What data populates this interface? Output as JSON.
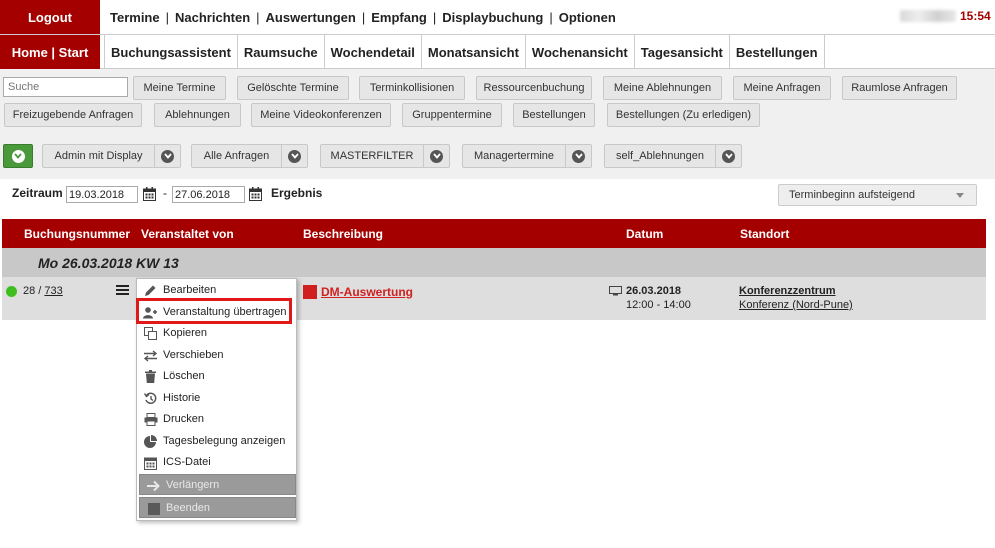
{
  "topbar": {
    "logout_label": "Logout",
    "nav": [
      "Termine",
      "Nachrichten",
      "Auswertungen",
      "Empfang",
      "Displaybuchung",
      "Optionen"
    ],
    "separator": "|",
    "clock": "15:54"
  },
  "tabbar": {
    "home_label": "Home | Start",
    "tabs": [
      "Buchungsassistent",
      "Raumsuche",
      "Wochendetail",
      "Monatsansicht",
      "Wochenansicht",
      "Tagesansicht",
      "Bestellungen"
    ]
  },
  "filters": {
    "search_placeholder": "Suche",
    "row1": [
      "Meine Termine",
      "Gelöschte Termine",
      "Terminkollisionen",
      "Ressourcenbuchung",
      "Meine Ablehnungen",
      "Meine Anfragen",
      "Raumlose Anfragen"
    ],
    "row2": [
      "Freizugebende Anfragen",
      "Ablehnungen",
      "Meine Videokonferenzen",
      "Gruppentermine",
      "Bestellungen",
      "Bestellungen (Zu erledigen)"
    ],
    "dropdowns": [
      "Admin mit Display",
      "Alle Anfragen",
      "MASTERFILTER",
      "Managertermine",
      "self_Ablehnungen"
    ]
  },
  "range": {
    "label": "Zeitraum",
    "from": "19.03.2018",
    "dash": "-",
    "to": "27.06.2018",
    "result_label": "Ergebnis",
    "sort_value": "Terminbeginn aufsteigend"
  },
  "table": {
    "headers": [
      "Buchungsnummer",
      "Veranstaltet von",
      "Beschreibung",
      "Datum",
      "Standort"
    ],
    "group_label": "Mo 26.03.2018 KW 13",
    "row": {
      "number_prefix": "28 / ",
      "number_link": "733",
      "description": "DM-Auswertung",
      "date": "26.03.2018",
      "time": "12:00 - 14:00",
      "location": "Konferenzzentrum",
      "location_sub": "Konferenz (Nord-Pune)",
      "status_color": "#3fbf1f"
    }
  },
  "context_menu": {
    "items": [
      {
        "label": "Bearbeiten",
        "icon": "pencil-icon"
      },
      {
        "label": "Veranstaltung übertragen",
        "icon": "transfer-user-icon"
      },
      {
        "label": "Kopieren",
        "icon": "copy-icon"
      },
      {
        "label": "Verschieben",
        "icon": "swap-arrows-icon"
      },
      {
        "label": "Löschen",
        "icon": "trash-icon"
      },
      {
        "label": "Historie",
        "icon": "history-icon"
      },
      {
        "label": "Drucken",
        "icon": "printer-icon"
      },
      {
        "label": "Tagesbelegung anzeigen",
        "icon": "pie-chart-icon"
      },
      {
        "label": "ICS-Datei",
        "icon": "calendar-icon"
      },
      {
        "label": "Verlängern",
        "icon": "arrow-right-icon"
      },
      {
        "label": "Beenden",
        "icon": "stop-icon"
      }
    ]
  },
  "colors": {
    "brand": "#a50000",
    "link_red": "#d01f1f",
    "status_green": "#3fbf1f"
  }
}
